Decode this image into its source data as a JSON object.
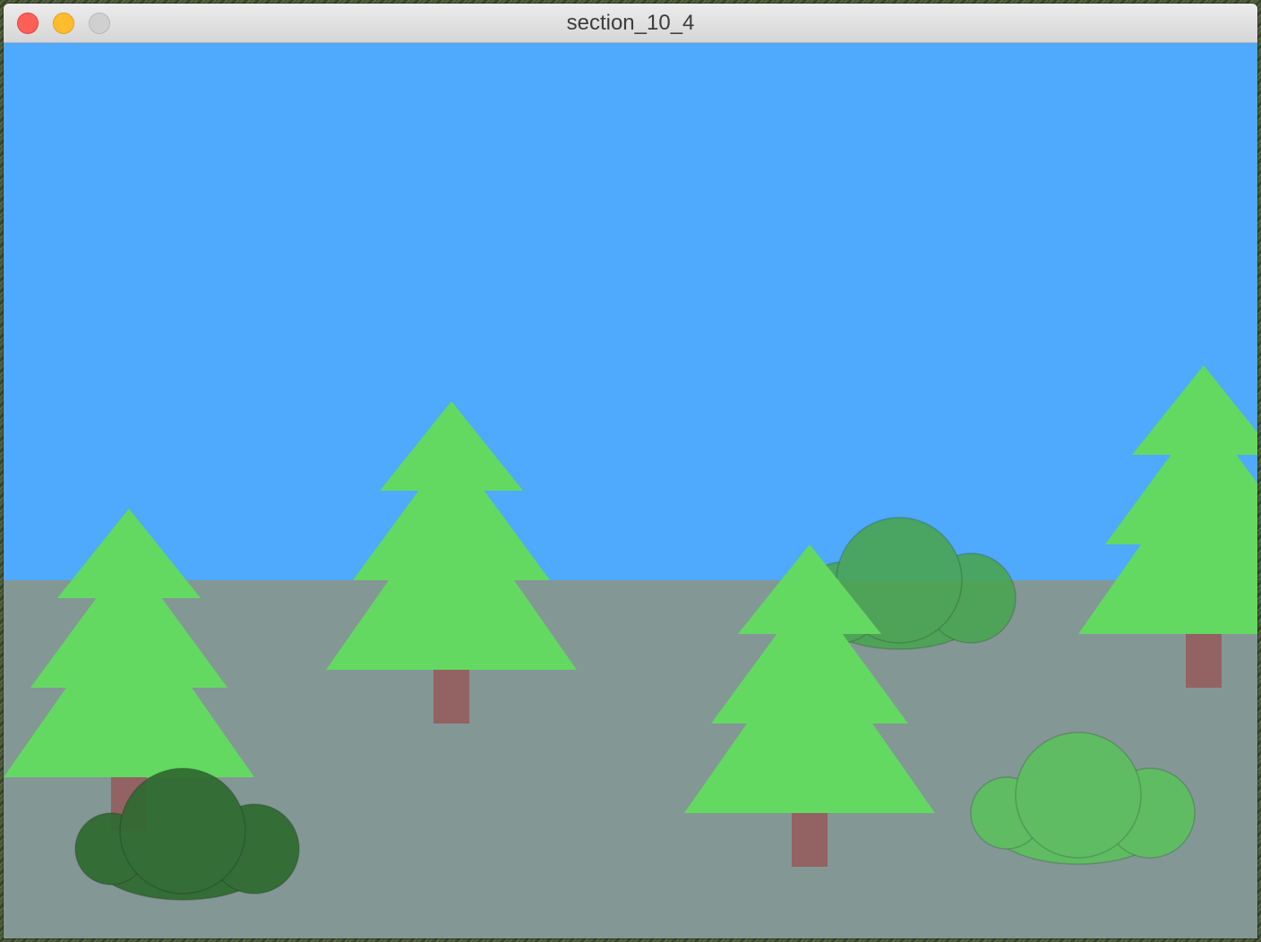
{
  "window": {
    "title": "section_10_4",
    "controls": {
      "close": "close-button",
      "minimize": "minimize-button",
      "zoom": "zoom-button"
    }
  },
  "scene": {
    "colors": {
      "sky": "#4fa9fd",
      "ground": "#839795",
      "tree_foliage": "#63d962",
      "tree_trunk": "#936262",
      "bush_dark": "#2f6a30",
      "bush_medium": "#4aa552",
      "bush_light": "#5cc05f"
    },
    "trees": 4,
    "bushes": 3
  }
}
